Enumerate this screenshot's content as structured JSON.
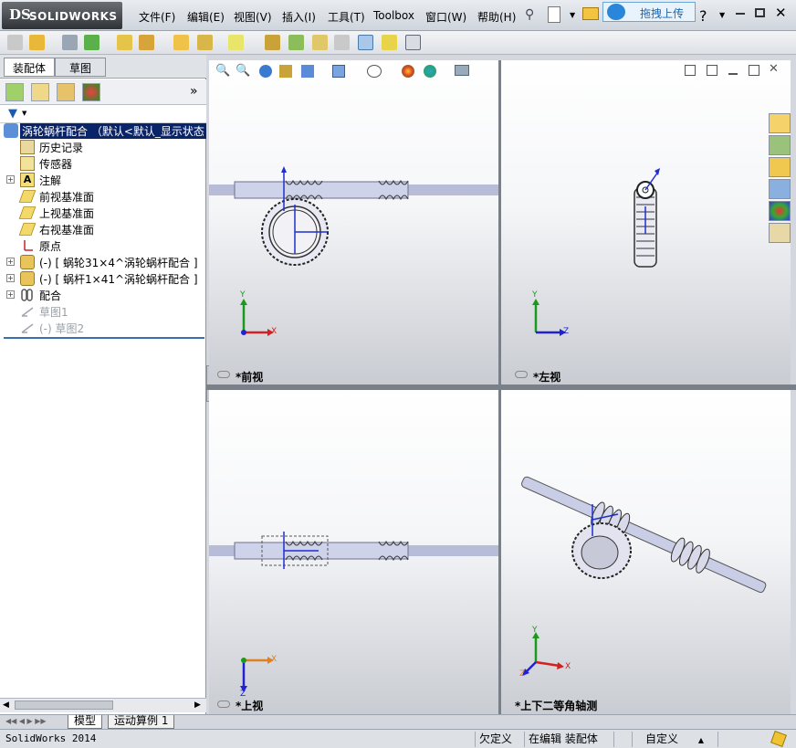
{
  "app": {
    "logo_ds": "DS",
    "logo_text": "SOLIDWORKS",
    "version_status": "SolidWorks 2014"
  },
  "menu": {
    "items": [
      "文件(F)",
      "编辑(E)",
      "视图(V)",
      "插入(I)",
      "工具(T)",
      "Toolbox",
      "窗口(W)",
      "帮助(H)"
    ]
  },
  "tooltip": {
    "text": "拖拽上传"
  },
  "panel": {
    "tabs": [
      "装配体",
      "草图"
    ],
    "expand_glyph": "»",
    "tree": [
      {
        "label": "涡轮蜗杆配合 （默认<默认_显示状态",
        "selected": true
      },
      {
        "label": "历史记录"
      },
      {
        "label": "传感器"
      },
      {
        "label": "注解"
      },
      {
        "label": "前视基准面"
      },
      {
        "label": "上视基准面"
      },
      {
        "label": "右视基准面"
      },
      {
        "label": "原点"
      },
      {
        "label": "(-) [ 蜗轮31×4^涡轮蜗杆配合 ]"
      },
      {
        "label": "(-) [ 蜗杆1×41^涡轮蜗杆配合 ]"
      },
      {
        "label": "配合"
      },
      {
        "label": "草图1",
        "gray": true
      },
      {
        "label": "(-) 草图2",
        "gray": true
      }
    ]
  },
  "viewports": {
    "front": {
      "label": "*前视",
      "axes": {
        "y": "Y",
        "x": "X"
      }
    },
    "left": {
      "label": "*左视",
      "axes": {
        "y": "Y",
        "x": "Z"
      }
    },
    "top": {
      "label": "*上视",
      "axes": {
        "x": "X",
        "z": "Z"
      }
    },
    "iso": {
      "label": "*上下二等角轴测",
      "axes": {
        "y": "Y",
        "x": "X",
        "z": "Z"
      }
    }
  },
  "bottom_tabs": [
    "模型",
    "运动算例 1"
  ],
  "status": {
    "underdefined": "欠定义",
    "editing": "在编辑 装配体",
    "custom": "自定义",
    "custom_caret": "▲"
  },
  "colors": {
    "axis_x": "#d42020",
    "axis_y": "#1a9a1a",
    "axis_z": "#2020d4",
    "selection": "#0a246a"
  }
}
